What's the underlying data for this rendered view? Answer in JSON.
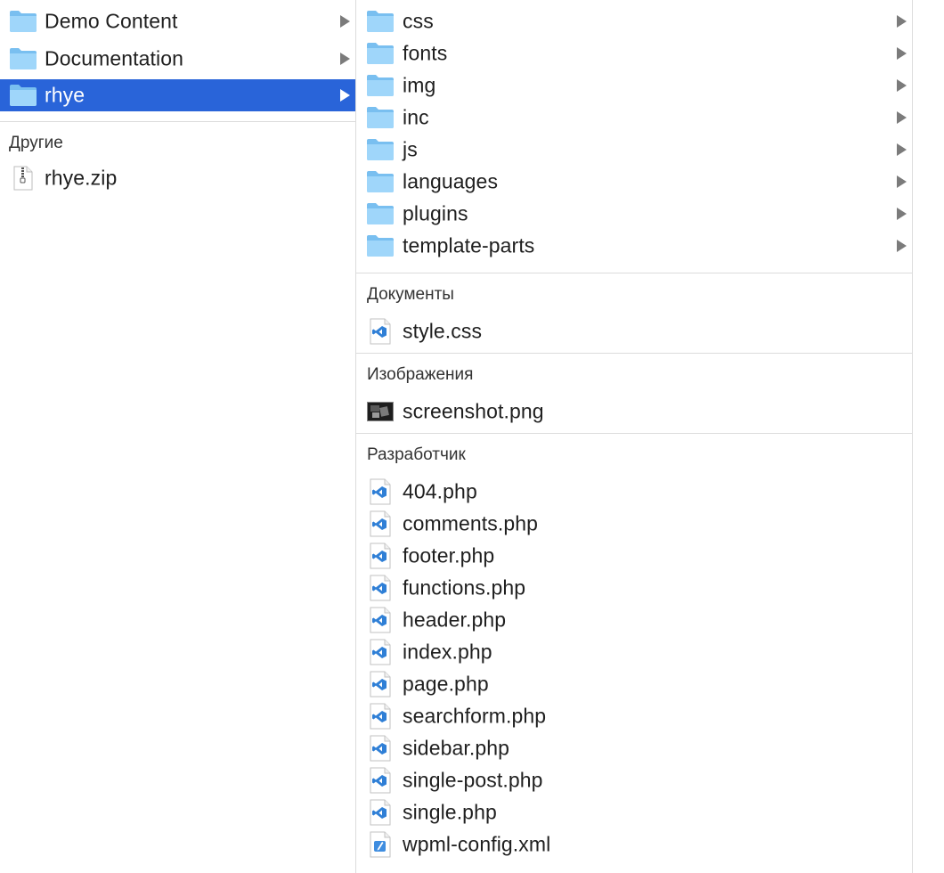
{
  "column1": {
    "folders": [
      {
        "label": "Demo Content"
      },
      {
        "label": "Documentation"
      },
      {
        "label": "rhye",
        "selected": true
      }
    ],
    "others_header": "Другие",
    "others": [
      {
        "label": "rhye.zip",
        "icon": "zip-file-icon"
      }
    ]
  },
  "column2": {
    "folders": [
      {
        "label": "css"
      },
      {
        "label": "fonts"
      },
      {
        "label": "img"
      },
      {
        "label": "inc"
      },
      {
        "label": "js"
      },
      {
        "label": "languages"
      },
      {
        "label": "plugins"
      },
      {
        "label": "template-parts"
      }
    ],
    "documents_header": "Документы",
    "documents": [
      {
        "label": "style.css",
        "icon": "vscode-file-icon"
      }
    ],
    "images_header": "Изображения",
    "images": [
      {
        "label": "screenshot.png",
        "icon": "image-thumbnail-icon"
      }
    ],
    "developer_header": "Разработчик",
    "developer": [
      {
        "label": "404.php",
        "icon": "vscode-file-icon"
      },
      {
        "label": "comments.php",
        "icon": "vscode-file-icon"
      },
      {
        "label": "footer.php",
        "icon": "vscode-file-icon"
      },
      {
        "label": "functions.php",
        "icon": "vscode-file-icon"
      },
      {
        "label": "header.php",
        "icon": "vscode-file-icon"
      },
      {
        "label": "index.php",
        "icon": "vscode-file-icon"
      },
      {
        "label": "page.php",
        "icon": "vscode-file-icon"
      },
      {
        "label": "searchform.php",
        "icon": "vscode-file-icon"
      },
      {
        "label": "sidebar.php",
        "icon": "vscode-file-icon"
      },
      {
        "label": "single-post.php",
        "icon": "vscode-file-icon"
      },
      {
        "label": "single.php",
        "icon": "vscode-file-icon"
      },
      {
        "label": "wpml-config.xml",
        "icon": "xml-file-icon"
      }
    ]
  },
  "colors": {
    "selection": "#2964d9",
    "folder": "#8ccbf5",
    "vscode_blue": "#2f7fd6"
  }
}
